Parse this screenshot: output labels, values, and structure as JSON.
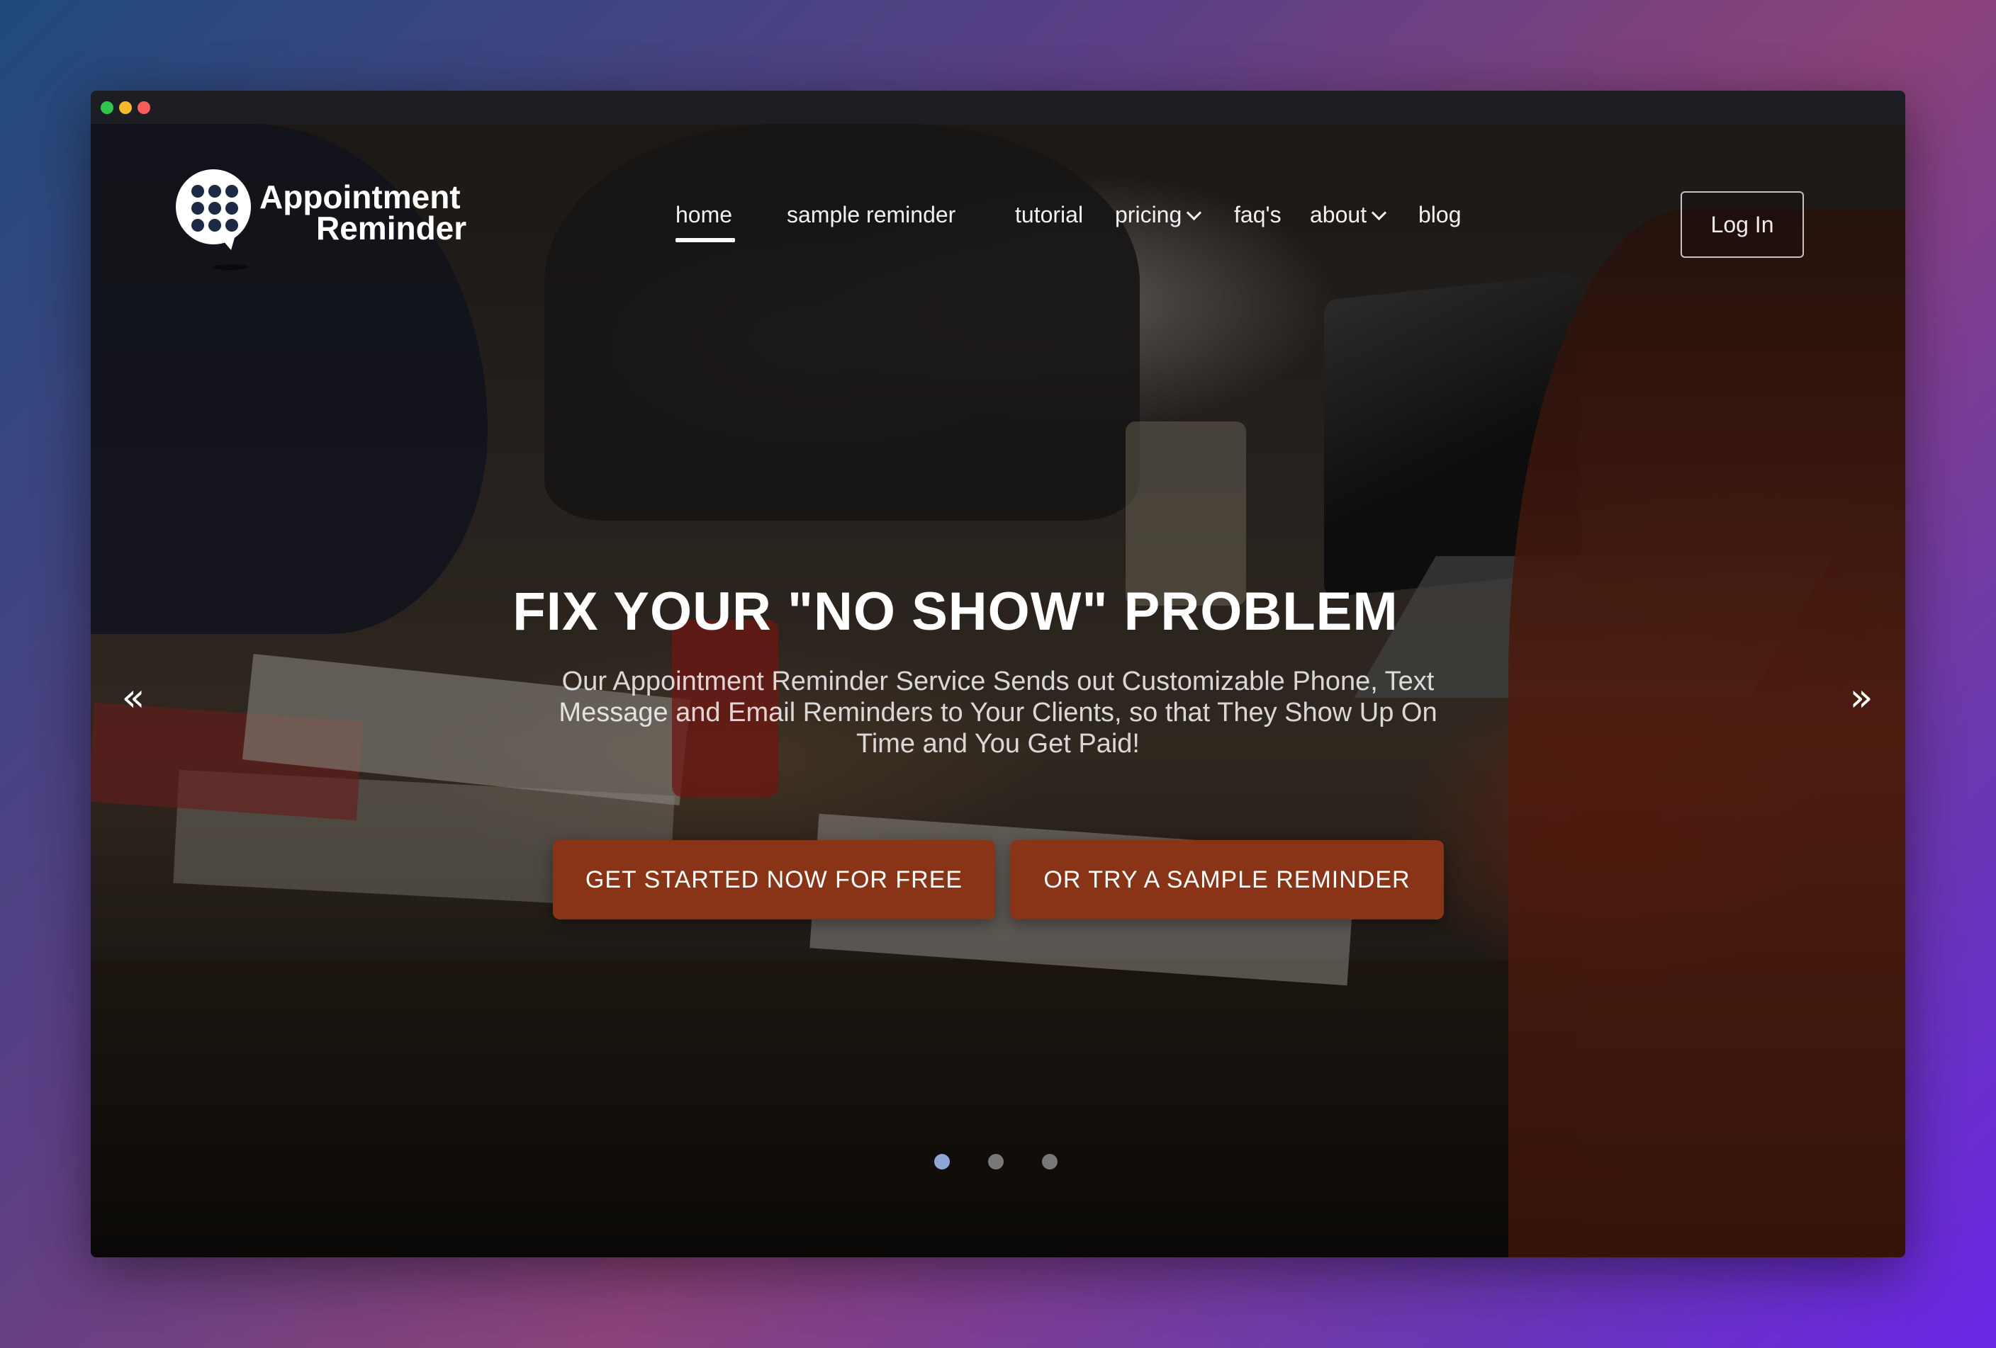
{
  "brand": {
    "line1": "Appointment",
    "line2": "Reminder"
  },
  "nav": {
    "items": [
      {
        "label": "home",
        "active": true,
        "dropdown": false
      },
      {
        "label": "sample reminder",
        "active": false,
        "dropdown": false
      },
      {
        "label": "tutorial",
        "active": false,
        "dropdown": false
      },
      {
        "label": "pricing",
        "active": false,
        "dropdown": true
      },
      {
        "label": "faq's",
        "active": false,
        "dropdown": false
      },
      {
        "label": "about",
        "active": false,
        "dropdown": true
      },
      {
        "label": "blog",
        "active": false,
        "dropdown": false
      }
    ],
    "login_label": "Log In"
  },
  "hero": {
    "headline": "FIX YOUR \"NO SHOW\" PROBLEM",
    "subtext": "Our Appointment Reminder Service Sends out Customizable Phone, Text Message and Email Reminders to Your Clients, so that They Show Up On Time and You Get Paid!",
    "cta_primary": "GET STARTED NOW FOR FREE",
    "cta_secondary": "OR TRY A SAMPLE REMINDER",
    "prev_icon": "«",
    "next_icon": "»",
    "slides": 3,
    "active_slide": 1
  },
  "colors": {
    "cta": "#8a3417",
    "active_indicator": "#8ea6d6",
    "logo_dots": "#1d2a44"
  }
}
